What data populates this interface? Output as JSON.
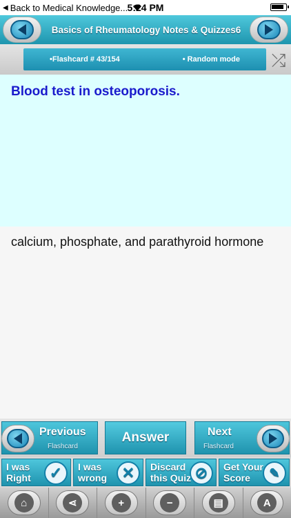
{
  "status_bar": {
    "back_label": "Back to Medical Knowledge...",
    "time": "5:24 PM"
  },
  "header": {
    "title": "Basics of Rheumatology Notes & Quizzes6"
  },
  "info": {
    "flashcard": "•Flashcard #  43/154",
    "mode": "• Random mode"
  },
  "question": {
    "text": "Blood test in osteoporosis."
  },
  "answer": {
    "text": "calcium, phosphate, and parathyroid hormone"
  },
  "nav": {
    "previous_label": "Previous",
    "previous_sub": "Flashcard",
    "answer_label": "Answer",
    "next_label": "Next",
    "next_sub": "Flashcard"
  },
  "score": {
    "right_label": "I was Right",
    "wrong_label": "I was wrong",
    "discard_label": "Discard this Quiz",
    "get_score_label": "Get Your Score"
  },
  "colors": {
    "header_teal": "#1e95ae",
    "question_bg": "#ddffff",
    "question_text": "#1a1acc"
  },
  "toolbar": {
    "icons": [
      "home-icon",
      "share-icon",
      "zoom-in-icon",
      "zoom-out-icon",
      "notes-icon",
      "font-icon"
    ]
  }
}
